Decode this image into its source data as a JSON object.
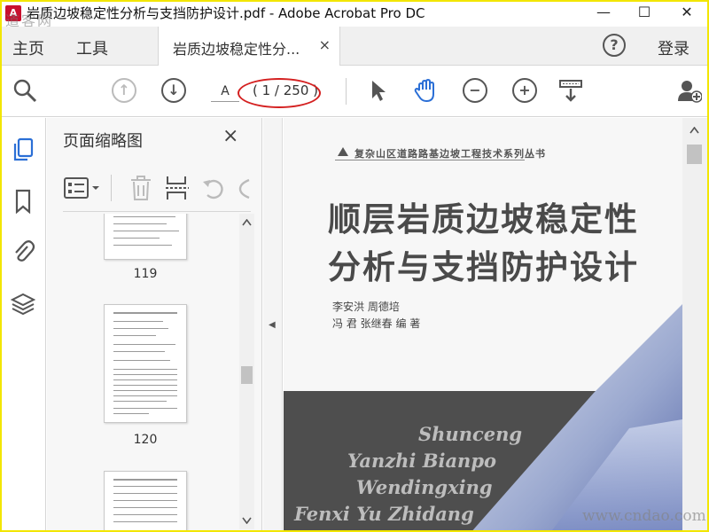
{
  "window": {
    "title": "岩质边坡稳定性分析与支挡防护设计.pdf - Adobe Acrobat Pro DC",
    "minimize": "—",
    "maximize": "☐",
    "close": "✕"
  },
  "nav": {
    "home": "主页",
    "tools": "工具",
    "doc_tab": "岩质边坡稳定性分...",
    "doc_tab_close": "×",
    "help": "?",
    "login": "登录"
  },
  "toolbar": {
    "page_input": "A",
    "page_count": "( 1 / 250 )"
  },
  "thumbnails": {
    "title": "页面缩略图",
    "close": "×",
    "pages": [
      "119",
      "120"
    ]
  },
  "document": {
    "series": "复杂山区道路路基边坡工程技术系列丛书",
    "title_line1": "顺层岩质边坡稳定性",
    "title_line2": "分析与支挡防护设计",
    "authors_line1": "李安洪   周德培",
    "authors_line2": "冯    君   张继春       编 著",
    "pinyin": [
      "Shunceng",
      "Yanzhi Bianpo",
      "Wendingxing",
      "Fenxi Yu Zhidang"
    ]
  },
  "watermark": {
    "logo": "道客网",
    "site": "www.cndao.com"
  },
  "colors": {
    "accent_blue": "#2b6fd6",
    "annotation_red": "#d42020",
    "frame_yellow": "#f2e600"
  }
}
